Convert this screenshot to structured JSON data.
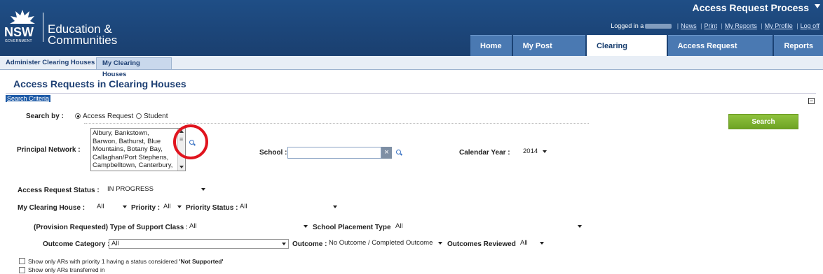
{
  "brand": {
    "logo_text": "NSW",
    "logo_sub": "GOVERNMENT",
    "line1": "Education &",
    "line2": "Communities"
  },
  "header": {
    "app_title": "Access Request Process",
    "logged_in_label": "Logged in a",
    "links": [
      "News",
      "Print",
      "My Reports",
      "My Profile",
      "Log off"
    ]
  },
  "nav": {
    "tabs": [
      "Home",
      "My Post Office",
      "Clearing Houses",
      "Access Request Panels",
      "Reports"
    ],
    "active": "Clearing Houses"
  },
  "subtabs": [
    "Administer Clearing Houses",
    "My Clearing Houses"
  ],
  "page_title": "Access Requests in Clearing Houses",
  "search_criteria_label": "Search Criteria",
  "search_by": {
    "label": "Search by :",
    "options": [
      "Access Request",
      "Student"
    ],
    "selected": "Access Request"
  },
  "search_button": "Search",
  "principal_network": {
    "label": "Principal Network :",
    "items": [
      "Albury, Bankstown,",
      "Barwon, Bathurst, Blue",
      "Mountains, Botany Bay,",
      "Callaghan/Port Stephens,",
      "Campbelltown, Canterbury,"
    ]
  },
  "school": {
    "label": "School :",
    "value": "",
    "clear": "×"
  },
  "calendar_year": {
    "label": "Calendar Year :",
    "value": "2014"
  },
  "access_request_status": {
    "label": "Access Request Status :",
    "value": "IN PROGRESS"
  },
  "my_clearing_house": {
    "label": "My Clearing House :",
    "value": "All"
  },
  "priority": {
    "label": "Priority :",
    "value": "All"
  },
  "priority_status": {
    "label": "Priority Status :",
    "value": "All"
  },
  "type_of_support_class": {
    "label": "(Provision Requested) Type of Support Class :",
    "value": "All"
  },
  "school_placement_type": {
    "label": "School Placement Type :",
    "value": "All"
  },
  "outcome_category": {
    "label": "Outcome Category :",
    "value": "All"
  },
  "outcome": {
    "label": "Outcome :",
    "value": "No Outcome / Completed Outcome"
  },
  "outcomes_reviewed": {
    "label": "Outcomes Reviewed :",
    "value": "All"
  },
  "checkboxes": {
    "not_supported_prefix": "Show only ARs with priority 1 having a status considered ",
    "not_supported_bold": "'Not Supported'",
    "transferred": "Show only ARs transferred in"
  }
}
